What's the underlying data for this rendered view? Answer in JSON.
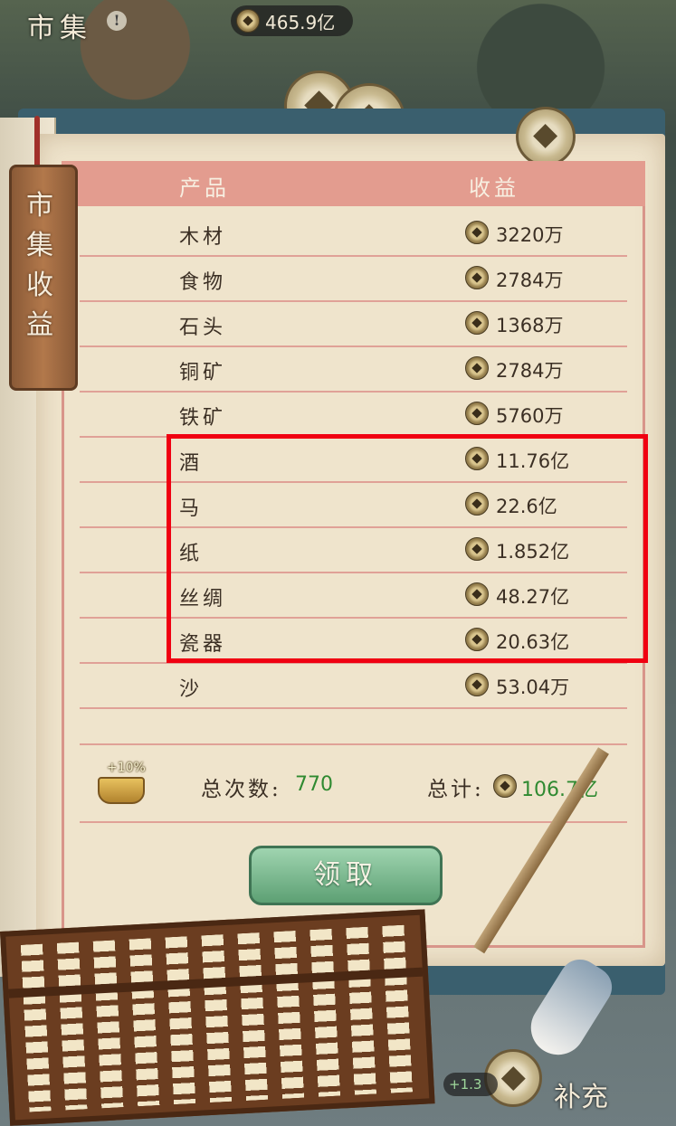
{
  "top": {
    "title": "市集",
    "info": "!",
    "gold": "465.9亿"
  },
  "bookmark": {
    "title": "市集收益"
  },
  "table": {
    "headers": {
      "product": "产品",
      "income": "收益"
    },
    "rows": [
      {
        "name": "木材",
        "value": "3220万"
      },
      {
        "name": "食物",
        "value": "2784万"
      },
      {
        "name": "石头",
        "value": "1368万"
      },
      {
        "name": "铜矿",
        "value": "2784万"
      },
      {
        "name": "铁矿",
        "value": "5760万"
      },
      {
        "name": "酒",
        "value": "11.76亿"
      },
      {
        "name": "马",
        "value": "22.6亿"
      },
      {
        "name": "纸",
        "value": "1.852亿"
      },
      {
        "name": "丝绸",
        "value": "48.27亿"
      },
      {
        "name": "瓷器",
        "value": "20.63亿"
      },
      {
        "name": "沙",
        "value": "53.04万"
      }
    ]
  },
  "summary": {
    "bonus": "+10%",
    "count_label": "总次数:",
    "count_value": "770",
    "total_label": "总计:",
    "total_value": "106.7亿"
  },
  "claim_button": "领取",
  "bottom": {
    "pill": "+1.3",
    "label": "补充"
  }
}
